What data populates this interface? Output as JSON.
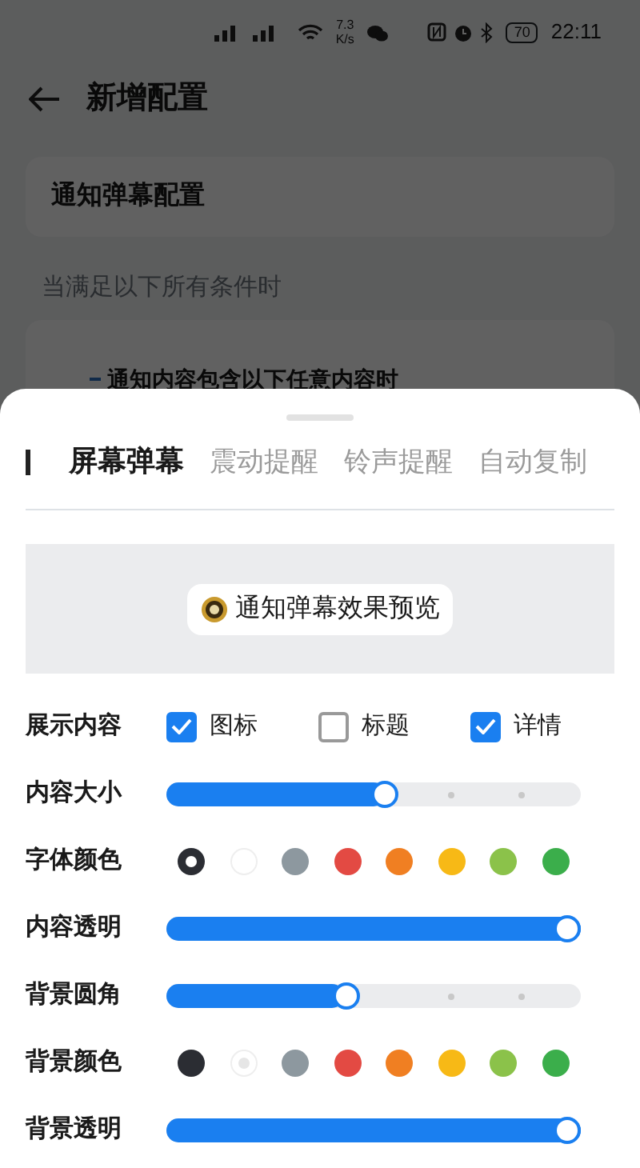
{
  "status_bar": {
    "network_speed": "7.3",
    "network_speed_unit": "K/s",
    "battery": "70",
    "time": "22:11"
  },
  "header": {
    "title": "新增配置"
  },
  "config_card": {
    "title": "通知弹幕配置"
  },
  "conditions_label": "当满足以下所有条件时",
  "condition_card": {
    "text": "通知内容包含以下任意内容时"
  },
  "sheet": {
    "tabs": [
      {
        "label": "屏幕弹幕",
        "selected": true
      },
      {
        "label": "震动提醒",
        "selected": false
      },
      {
        "label": "铃声提醒",
        "selected": false
      },
      {
        "label": "自动复制",
        "selected": false
      }
    ],
    "preview": {
      "text": "通知弹幕效果预览"
    },
    "rows": [
      {
        "kind": "checkboxes",
        "label": "展示内容",
        "options": [
          {
            "label": "图标",
            "checked": true
          },
          {
            "label": "标题",
            "checked": false
          },
          {
            "label": "详情",
            "checked": true
          }
        ]
      },
      {
        "kind": "slider",
        "label": "内容大小",
        "level": 0.53,
        "steps": true
      },
      {
        "kind": "colors",
        "label": "字体颜色",
        "swatches": [
          {
            "color": "#2b2d33",
            "selected": true
          },
          {
            "color": "#ffffff",
            "selected": false
          },
          {
            "color": "#8d989f",
            "selected": false
          },
          {
            "color": "#e34a43",
            "selected": false
          },
          {
            "color": "#f07f22",
            "selected": false
          },
          {
            "color": "#f7b916",
            "selected": false
          },
          {
            "color": "#8bc24a",
            "selected": false
          },
          {
            "color": "#3bae4b",
            "selected": false
          }
        ]
      },
      {
        "kind": "slider",
        "label": "内容透明",
        "level": 1,
        "steps": false
      },
      {
        "kind": "slider",
        "label": "背景圆角",
        "level": 0.43,
        "steps": true
      },
      {
        "kind": "colors",
        "label": "背景颜色",
        "swatches": [
          {
            "color": "#2b2d33",
            "selected": false
          },
          {
            "color": "#ffffff",
            "selected": true
          },
          {
            "color": "#8d989f",
            "selected": false
          },
          {
            "color": "#e34a43",
            "selected": false
          },
          {
            "color": "#f07f22",
            "selected": false
          },
          {
            "color": "#f7b916",
            "selected": false
          },
          {
            "color": "#8bc24a",
            "selected": false
          },
          {
            "color": "#3bae4b",
            "selected": false
          }
        ]
      },
      {
        "kind": "slider",
        "label": "背景透明",
        "level": 1,
        "steps": false
      }
    ]
  }
}
